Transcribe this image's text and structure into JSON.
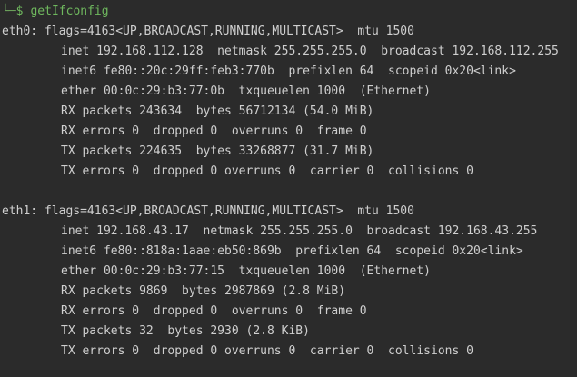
{
  "prompt": {
    "corner": "└─",
    "dollar": "$",
    "command": "getIfconfig"
  },
  "interfaces": [
    {
      "header": "eth0: flags=4163<UP,BROADCAST,RUNNING,MULTICAST>  mtu 1500",
      "inet": "inet 192.168.112.128  netmask 255.255.255.0  broadcast 192.168.112.255",
      "inet6": "inet6 fe80::20c:29ff:feb3:770b  prefixlen 64  scopeid 0x20<link>",
      "ether": "ether 00:0c:29:b3:77:0b  txqueuelen 1000  (Ethernet)",
      "rx_packets": "RX packets 243634  bytes 56712134 (54.0 MiB)",
      "rx_errors": "RX errors 0  dropped 0  overruns 0  frame 0",
      "tx_packets": "TX packets 224635  bytes 33268877 (31.7 MiB)",
      "tx_errors": "TX errors 0  dropped 0 overruns 0  carrier 0  collisions 0"
    },
    {
      "header": "eth1: flags=4163<UP,BROADCAST,RUNNING,MULTICAST>  mtu 1500",
      "inet": "inet 192.168.43.17  netmask 255.255.255.0  broadcast 192.168.43.255",
      "inet6": "inet6 fe80::818a:1aae:eb50:869b  prefixlen 64  scopeid 0x20<link>",
      "ether": "ether 00:0c:29:b3:77:15  txqueuelen 1000  (Ethernet)",
      "rx_packets": "RX packets 9869  bytes 2987869 (2.8 MiB)",
      "rx_errors": "RX errors 0  dropped 0  overruns 0  frame 0",
      "tx_packets": "TX packets 32  bytes 2930 (2.8 KiB)",
      "tx_errors": "TX errors 0  dropped 0 overruns 0  carrier 0  collisions 0"
    }
  ],
  "colors": {
    "background": "#2b2b2b",
    "text": "#cfcfcf",
    "prompt": "#6fb85e"
  }
}
